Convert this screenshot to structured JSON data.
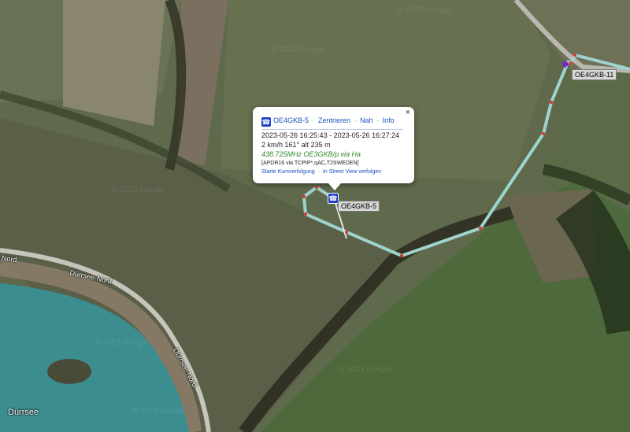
{
  "stations": [
    {
      "id": "s5",
      "label": "OE4GKB-5"
    },
    {
      "id": "s11",
      "label": "OE4GKB-11"
    }
  ],
  "places": {
    "lake": "Dürrsee",
    "road_left": "Nord",
    "road_mid": "Dürrsee-Nord",
    "road_curve": "Dürrsee-Nord"
  },
  "watermark": "© 2023 Google",
  "popup": {
    "callsign": "OE4GKB-5",
    "links": [
      "Zentrieren",
      "Nah",
      "Info"
    ],
    "timespan": "2023-05-26 16:25:43 - 2023-05-26 16:27:24",
    "motion": "2 km/h 161° alt 235 m",
    "frequency": "438.725MHz OE3GKB/p via Ha",
    "path": "[APDR16 via TCPIP*,qAC,T2SWEDEN]",
    "actions": [
      "Starte Kursverfolgung",
      "In Street View verfolgen"
    ],
    "close": "×"
  },
  "colors": {
    "track": "#9fd3cd",
    "track_point": "#e0302a",
    "popup_link": "#1a4fbf",
    "frequency": "#2d8a2d",
    "symbol": "#1d3fc6"
  },
  "icons": {
    "station_symbol": "car-icon",
    "close": "close-icon"
  }
}
